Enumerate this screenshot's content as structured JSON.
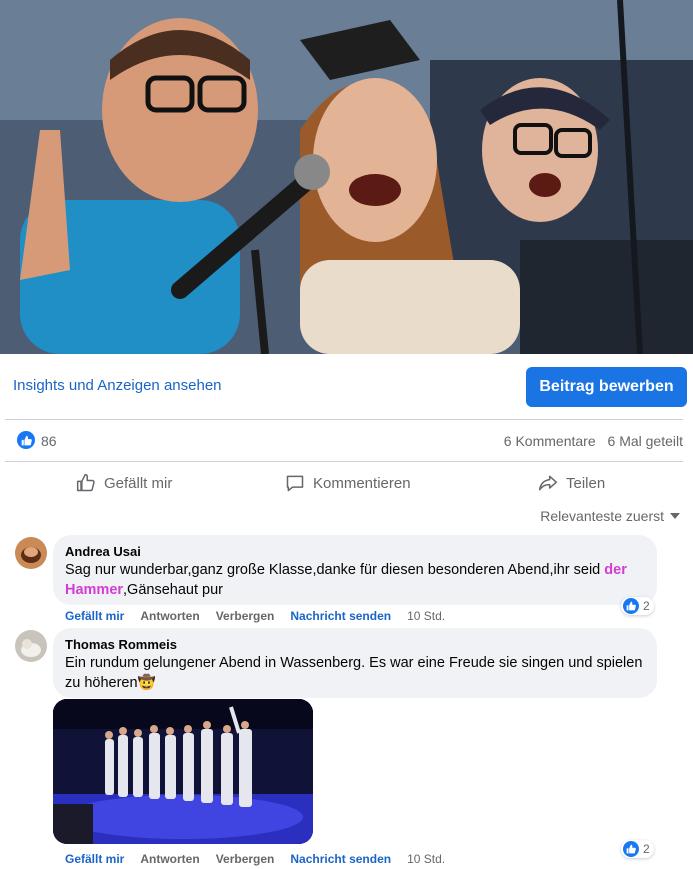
{
  "post": {
    "insights_link": "Insights und Anzeigen ansehen",
    "promote_button": "Beitrag bewerben"
  },
  "stats": {
    "like_count": "86",
    "comments": "6 Kommentare",
    "shares": "6 Mal geteilt"
  },
  "actions": {
    "like": "Gefällt mir",
    "comment": "Kommentieren",
    "share": "Teilen"
  },
  "sort": {
    "label": "Relevanteste zuerst"
  },
  "comments": [
    {
      "author": "Andrea Usai",
      "text_before": "Sag nur wunderbar,ganz große Klasse,danke für diesen besonderen Abend,ihr seid ",
      "text_highlight": "der Hammer",
      "text_after": ",Gänsehaut pur",
      "actions": {
        "like": "Gefällt mir",
        "reply": "Antworten",
        "hide": "Verbergen",
        "message": "Nachricht senden"
      },
      "time": "10 Std.",
      "reactions": "2"
    },
    {
      "author": "Thomas Rommeis",
      "text": "Ein rundum gelungener Abend in Wassenberg. Es war eine Freude sie singen und spielen zu höheren🤠",
      "actions": {
        "like": "Gefällt mir",
        "reply": "Antworten",
        "hide": "Verbergen",
        "message": "Nachricht senden"
      },
      "time": "10 Std.",
      "reactions": "2"
    }
  ],
  "icons": {
    "like": "thumbs-up-icon",
    "comment": "speech-bubble-icon",
    "share": "share-arrow-icon",
    "sort": "chevron-down-icon"
  },
  "colors": {
    "accent": "#1b74e4",
    "link": "#1b64c8",
    "highlight": "#d63bd6",
    "bubble": "#f0f2f5"
  }
}
